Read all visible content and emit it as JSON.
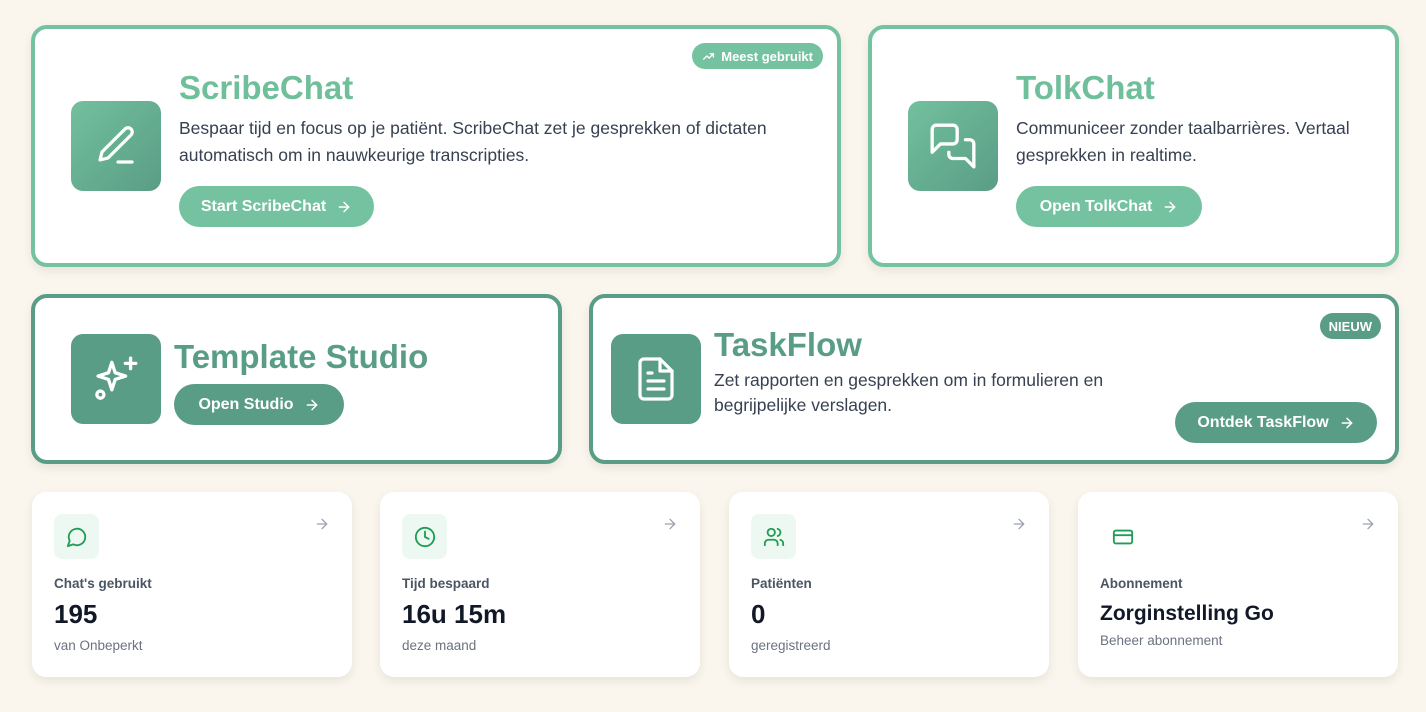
{
  "colors": {
    "accent_light": "#74c2a0",
    "accent_dark": "#5a9d86",
    "background": "#faf6ee",
    "stat_icon_green": "#1f9d55"
  },
  "scribechat": {
    "badge": "Meest gebruikt",
    "badge_icon": "trending-up-icon",
    "icon": "pencil-icon",
    "title": "ScribeChat",
    "description": "Bespaar tijd en focus op je patiënt. ScribeChat zet je gesprekken of dictaten automatisch om in nauwkeurige transcripties.",
    "button": "Start ScribeChat"
  },
  "tolkchat": {
    "icon": "chat-bubbles-icon",
    "title": "TolkChat",
    "description": "Communiceer zonder taalbarrières. Vertaal gesprekken in realtime.",
    "button": "Open TolkChat"
  },
  "template_studio": {
    "icon": "sparkles-icon",
    "title": "Template Studio",
    "button": "Open Studio"
  },
  "taskflow": {
    "badge": "NIEUW",
    "icon": "document-icon",
    "title": "TaskFlow",
    "description": "Zet rapporten en gesprekken om in formulieren en begrijpelijke verslagen.",
    "button": "Ontdek TaskFlow"
  },
  "stats": [
    {
      "icon": "message-circle-icon",
      "label": "Chat's gebruikt",
      "value": "195",
      "sub": "van Onbeperkt"
    },
    {
      "icon": "clock-icon",
      "label": "Tijd bespaard",
      "value": "16u 15m",
      "sub": "deze maand"
    },
    {
      "icon": "users-icon",
      "label": "Patiënten",
      "value": "0",
      "sub": "geregistreerd"
    },
    {
      "icon": "credit-card-icon",
      "label": "Abonnement",
      "value": "Zorginstelling Go",
      "sub": "Beheer abonnement"
    }
  ]
}
